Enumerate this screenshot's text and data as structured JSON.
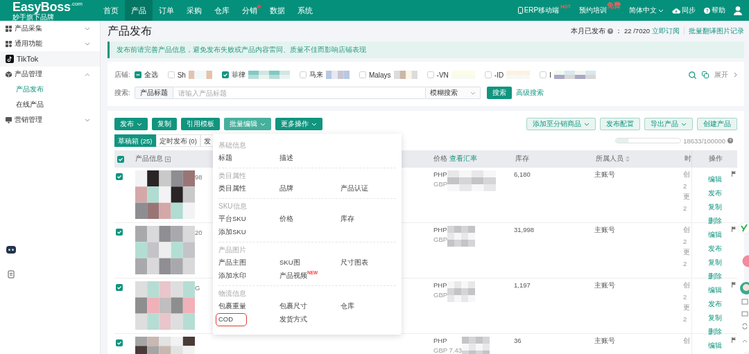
{
  "top_nav": {
    "logo": {
      "name": "EasyBoss",
      "domain": ".com",
      "tagline": "妙手旗下品牌"
    },
    "items": [
      {
        "label": "首页",
        "selected": false,
        "dot": false
      },
      {
        "label": "产品",
        "selected": true,
        "dot": false
      },
      {
        "label": "订单",
        "selected": false,
        "dot": false
      },
      {
        "label": "采购",
        "selected": false,
        "dot": false
      },
      {
        "label": "仓库",
        "selected": false,
        "dot": false
      },
      {
        "label": "分销",
        "selected": false,
        "dot": true
      },
      {
        "label": "数据",
        "selected": false,
        "dot": false
      },
      {
        "label": "系统",
        "selected": false,
        "dot": false
      }
    ],
    "right": [
      {
        "kind": "phone",
        "label": "ERP移动端",
        "badge": "HOT"
      },
      {
        "kind": "plain",
        "label": "预约培训",
        "badge": "免费"
      },
      {
        "kind": "language",
        "label": "简体中文"
      },
      {
        "kind": "sync",
        "label": "同步"
      },
      {
        "kind": "help",
        "label": "帮助"
      },
      {
        "kind": "user"
      }
    ]
  },
  "sidebar": {
    "items": [
      {
        "kind": "grid",
        "label": "产品采集",
        "expanded": false
      },
      {
        "kind": "grid",
        "label": "通用功能",
        "expanded": false
      },
      {
        "kind": "tiktok",
        "label": "TikTok"
      },
      {
        "kind": "cube",
        "label": "产品管理",
        "expanded": true,
        "children": [
          {
            "label": "产品发布",
            "selected": true
          },
          {
            "label": "在线产品",
            "selected": false
          }
        ]
      },
      {
        "kind": "screen",
        "label": "营销管理",
        "expanded": false
      }
    ]
  },
  "page": {
    "title": "产品发布",
    "stats_label": "本月已发布",
    "stats_value": "： 22 /7020",
    "subscribe_link": "立即订阅",
    "records_link": "批量翻译图片记录"
  },
  "notice": "发布前请完善产品信息，避免发布失败或产品内容雷同、质量不佳而影响店铺表现",
  "filter": {
    "store_label": "店铺:",
    "stores": [
      {
        "label": "全选",
        "partial": true
      },
      {
        "label": "Sh",
        "checked": false
      },
      {
        "label": "菲律",
        "checked": true
      },
      {
        "label": "马来",
        "checked": false
      },
      {
        "label": "Malays",
        "checked": false
      },
      {
        "label": "-VN",
        "checked": false
      },
      {
        "label": "-ID",
        "checked": false
      },
      {
        "label": "I",
        "checked": false
      }
    ],
    "expand_link": "展开",
    "search_label": "搜索:",
    "search_prefix": "产品标题",
    "search_placeholder": "请输入产品标题",
    "mode": "模糊搜索",
    "search_button": "搜索",
    "advanced_link": "高级搜索"
  },
  "toolbar": {
    "left": [
      {
        "label": "发布",
        "caret": true,
        "active": false
      },
      {
        "label": "复制",
        "caret": false,
        "active": false
      },
      {
        "label": "引用模板",
        "caret": false,
        "active": false
      },
      {
        "label": "批量编辑",
        "caret": true,
        "active": true
      },
      {
        "label": "更多操作",
        "caret": true,
        "active": false
      }
    ],
    "right": [
      {
        "label": "添加至分销商品",
        "caret": true
      },
      {
        "label": "发布配置",
        "caret": false
      },
      {
        "label": "导出产品",
        "caret": true
      },
      {
        "label": "创建产品",
        "caret": false
      }
    ]
  },
  "tabs": [
    {
      "label": "草稿箱 (25)",
      "selected": true
    },
    {
      "label": "定时发布 (0)",
      "selected": false
    },
    {
      "label": "发",
      "selected": false
    }
  ],
  "quota": {
    "level": 0.19,
    "reading": "18633/100000"
  },
  "table": {
    "all_checked": true,
    "columns": [
      {
        "label": "产品信息"
      },
      {
        "label": "价格",
        "link": "查看汇率"
      },
      {
        "label": "库存"
      },
      {
        "label": "所属人员",
        "sortable": true
      },
      {
        "label": "时"
      },
      {
        "label": "操作"
      }
    ],
    "rows": [
      {
        "checked": true,
        "title": "98",
        "prices": [
          "PHP",
          "GBP"
        ],
        "stock": "6,180",
        "owner": "主账号",
        "time": [
          "创",
          "2",
          "更",
          "2"
        ],
        "actions": [
          "编辑",
          "发布",
          "复制",
          "删除"
        ]
      },
      {
        "checked": true,
        "title": "20",
        "prices": [
          "PHP",
          "GBP"
        ],
        "stock": "31,998",
        "owner": "主账号",
        "time": [
          "创",
          "2",
          "更",
          "2"
        ],
        "actions": [
          "编辑",
          "发布",
          "复制",
          "删除"
        ]
      },
      {
        "checked": true,
        "title": "G",
        "prices": [
          "PHP",
          "GBP"
        ],
        "stock": "1,197",
        "owner": "主账号",
        "time": [
          "创",
          "2",
          "更",
          "2"
        ],
        "actions": [
          "编辑",
          "发布",
          "复制",
          "删除"
        ]
      },
      {
        "checked": true,
        "title": "",
        "prices": [
          "PHP",
          "GBP 7.43"
        ],
        "stock": "36",
        "owner": "主账号",
        "time": [
          "创"
        ],
        "actions": [
          "编辑"
        ]
      }
    ]
  },
  "batch_menu": {
    "sections": [
      {
        "title": "基础信息",
        "items": [
          {
            "label": "标题"
          },
          {
            "label": "描述"
          }
        ]
      },
      {
        "title": "类目属性",
        "items": [
          {
            "label": "类目属性"
          },
          {
            "label": "品牌"
          },
          {
            "label": "产品认证"
          }
        ]
      },
      {
        "title": "SKU信息",
        "items": [
          {
            "label": "平台SKU"
          },
          {
            "label": "价格"
          },
          {
            "label": "库存"
          },
          {
            "label": "添加SKU"
          }
        ]
      },
      {
        "title": "产品图片",
        "items": [
          {
            "label": "产品主图"
          },
          {
            "label": "SKU图"
          },
          {
            "label": "尺寸图表"
          },
          {
            "label": "添加水印"
          },
          {
            "label": "产品视频",
            "badge": "NEW"
          }
        ]
      },
      {
        "title": "物流信息",
        "items": [
          {
            "label": "包裹重量"
          },
          {
            "label": "包裹尺寸"
          },
          {
            "label": "仓库"
          },
          {
            "label": "COD",
            "highlighted": true
          },
          {
            "label": "发货方式"
          }
        ]
      }
    ]
  }
}
